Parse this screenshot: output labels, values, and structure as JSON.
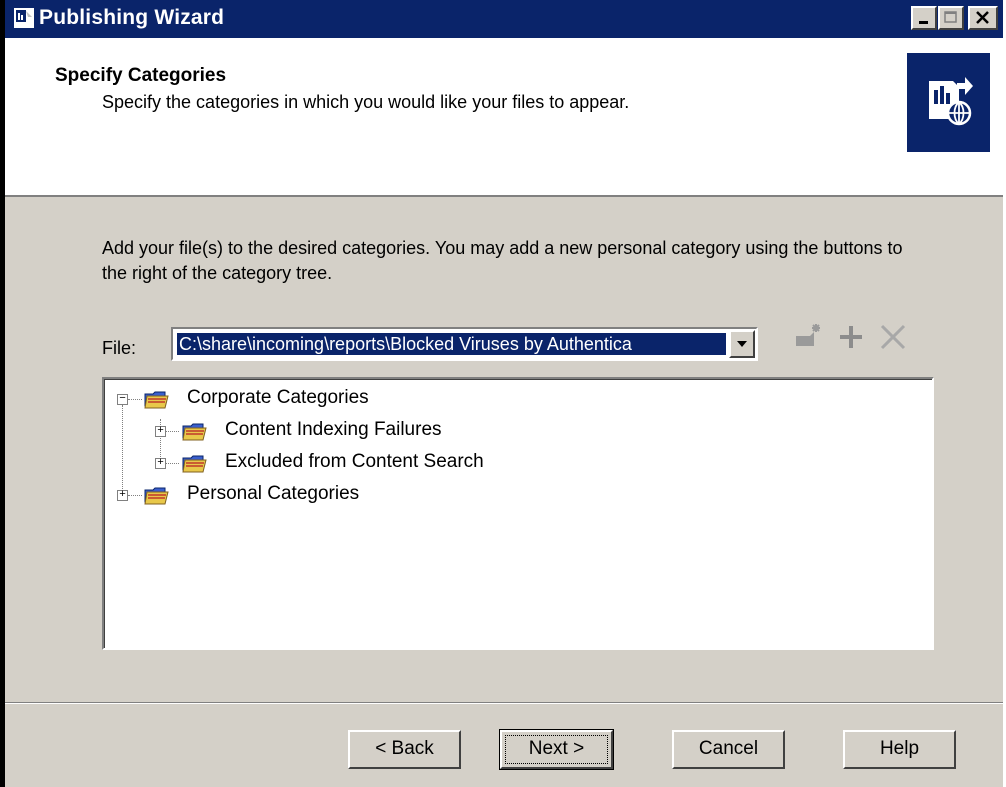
{
  "window": {
    "title": "Publishing Wizard",
    "icon": "publishing-wizard-icon"
  },
  "header": {
    "title": "Specify Categories",
    "subtitle": "Specify the categories in which you would like your files to appear.",
    "badge_icon": "publish-globe-icon"
  },
  "body": {
    "instructions": "Add your file(s) to the desired categories.  You may add a new personal category using the buttons to the right of the category tree.",
    "file_label": "File:",
    "file_value": "C:\\share\\incoming\\reports\\Blocked Viruses by Authentica",
    "toolbar": [
      "new-category-icon",
      "add-icon",
      "delete-icon"
    ]
  },
  "tree": {
    "items": [
      {
        "label": "Corporate Categories",
        "expanded": true,
        "level": 0
      },
      {
        "label": "Content Indexing Failures",
        "expanded": false,
        "level": 1
      },
      {
        "label": "Excluded from Content Search",
        "expanded": false,
        "level": 1
      },
      {
        "label": "Personal Categories",
        "expanded": false,
        "level": 0
      }
    ]
  },
  "buttons": {
    "back": "< Back",
    "next": "Next >",
    "cancel": "Cancel",
    "help": "Help"
  },
  "colors": {
    "titlebar": "#0a246a",
    "face": "#d4d0c8",
    "selection": "#0a246a"
  }
}
